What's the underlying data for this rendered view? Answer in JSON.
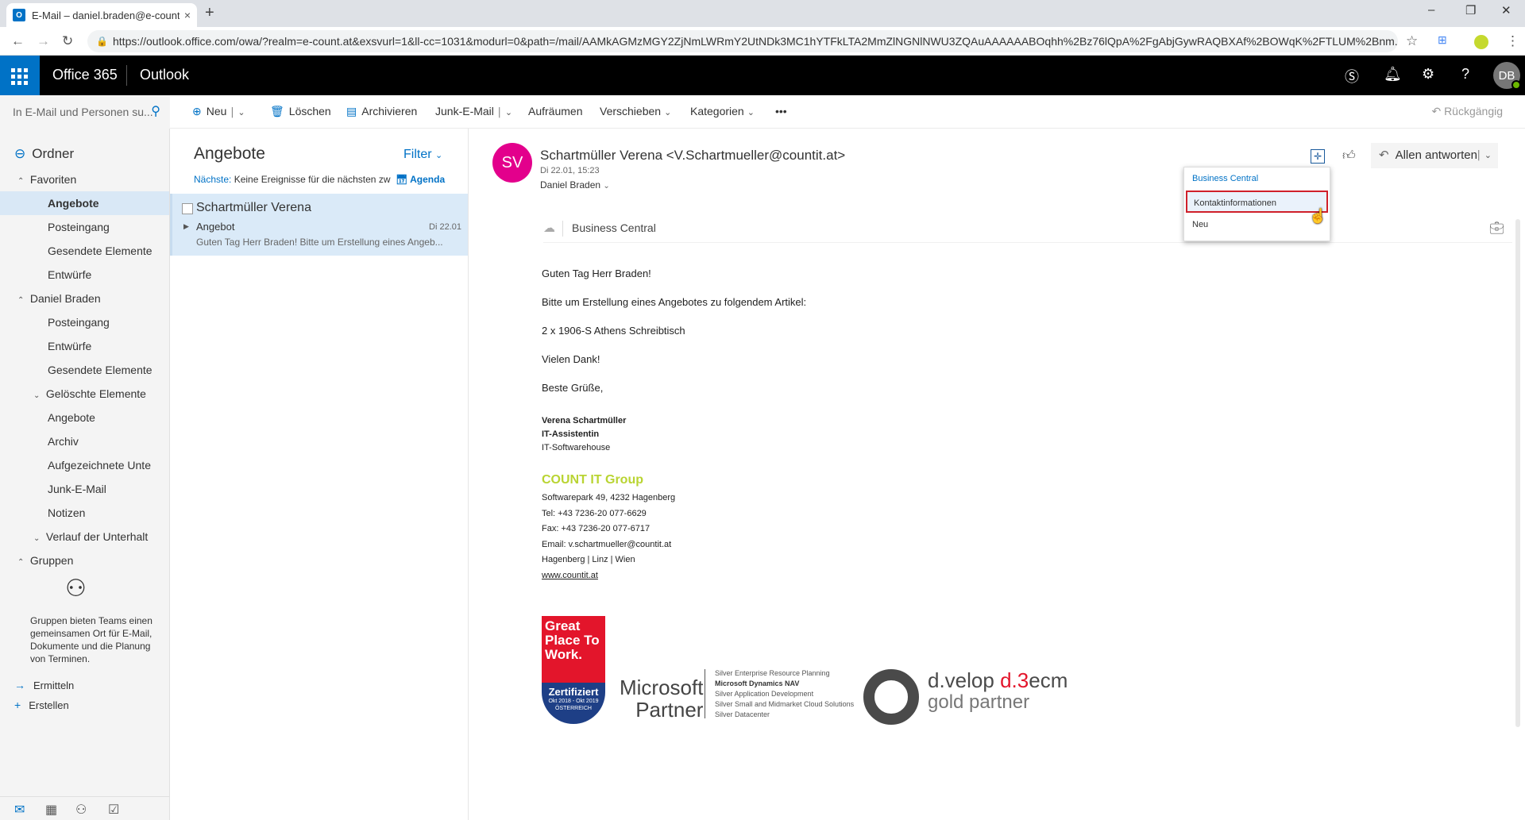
{
  "browser": {
    "tab_title": "E-Mail – daniel.braden@e-count.",
    "tab_close": "×",
    "new_tab": "+",
    "url": "https://outlook.office.com/owa/?realm=e-count.at&exsvurl=1&ll-cc=1031&modurl=0&path=/mail/AAMkAGMzMGY2ZjNmLWRmY2UtNDk3MC1hYTFkLTA2MmZlNGNlNWU3ZQAuAAAAAABOqhh%2Bz76lQpA%2FgAbjGywRAQBXAf%2BOWqK%2FTLUM%2Bnm...",
    "controls": {
      "minimize": "–",
      "restore": "❐",
      "close": "✕"
    }
  },
  "header": {
    "suite": "Office 365",
    "app": "Outlook",
    "avatar": "DB"
  },
  "commands": {
    "search_placeholder": "In E-Mail und Personen su...",
    "new": "Neu",
    "delete": "Löschen",
    "archive": "Archivieren",
    "junk": "Junk-E-Mail",
    "cleanup": "Aufräumen",
    "move": "Verschieben",
    "categories": "Kategorien",
    "more": "•••",
    "undo": "Rückgängig"
  },
  "nav": {
    "title": "Ordner",
    "favorites_label": "Favoriten",
    "favorites": [
      "Angebote",
      "Posteingang",
      "Gesendete Elemente",
      "Entwürfe"
    ],
    "account_label": "Daniel Braden",
    "account_folders": [
      "Posteingang",
      "Entwürfe",
      "Gesendete Elemente",
      "Gelöschte Elemente",
      "Angebote",
      "Archiv",
      "Aufgezeichnete Unte",
      "Junk-E-Mail",
      "Notizen",
      "Verlauf der Unterhalt"
    ],
    "groups_label": "Gruppen",
    "groups_desc": "Gruppen bieten Teams einen gemeinsamen Ort für E-Mail, Dokumente und die Planung von Terminen.",
    "discover": "Ermitteln",
    "create": "Erstellen"
  },
  "list": {
    "folder": "Angebote",
    "filter": "Filter",
    "next_label": "Nächste:",
    "next_text": "Keine Ereignisse für die nächsten zw",
    "agenda": "Agenda",
    "message": {
      "from": "Schartmüller Verena",
      "subject": "Angebot",
      "date": "Di 22.01",
      "preview": "Guten Tag Herr Braden!  Bitte um Erstellung eines Angeb..."
    }
  },
  "reading": {
    "initials": "SV",
    "sender": "Schartmüller Verena <V.Schartmueller@countit.at>",
    "datetime": "Di 22.01, 15:23",
    "recipient": "Daniel Braden",
    "reply_all": "Allen antworten",
    "addin_label": "Business Central",
    "body": [
      "Guten Tag Herr Braden!",
      "Bitte um Erstellung eines Angebotes zu folgendem Artikel:",
      "2 x 1906-S Athens Schreibtisch",
      "Vielen Dank!",
      "Beste Grüße,"
    ],
    "signature": {
      "name": "Verena Schartmüller",
      "title": "IT-Assistentin",
      "dept": "IT-Softwarehouse",
      "company": "COUNT IT Group",
      "address": "Softwarepark 49, 4232 Hagenberg",
      "tel": "Tel:      +43 7236-20 077-6629",
      "fax": "Fax:     +43 7236-20 077-6717",
      "email": "Email: v.schartmueller@countit.at",
      "locations": "Hagenberg | Linz | Wien",
      "web": "www.countit.at"
    },
    "logos": {
      "gptw_top": "Great Place To Work.",
      "gptw_cert": "Zertifiziert",
      "gptw_period": "Okt 2018 - Okt 2019",
      "gptw_country": "ÖSTERREICH",
      "ms_line1": "Microsoft",
      "ms_line2": "Partner",
      "ms_competencies": [
        "Silver Enterprise Resource Planning",
        "Microsoft Dynamics NAV",
        "Silver Application Development",
        "Silver Small and Midmarket Cloud Solutions",
        "Silver Datacenter"
      ],
      "dvelop_a": "d.velop ",
      "dvelop_b": "d.3",
      "dvelop_c": "ecm",
      "dvelop_partner": "gold partner"
    }
  },
  "dropdown": {
    "header": "Business Central",
    "items": [
      "Kontaktinformationen",
      "Neu"
    ]
  }
}
